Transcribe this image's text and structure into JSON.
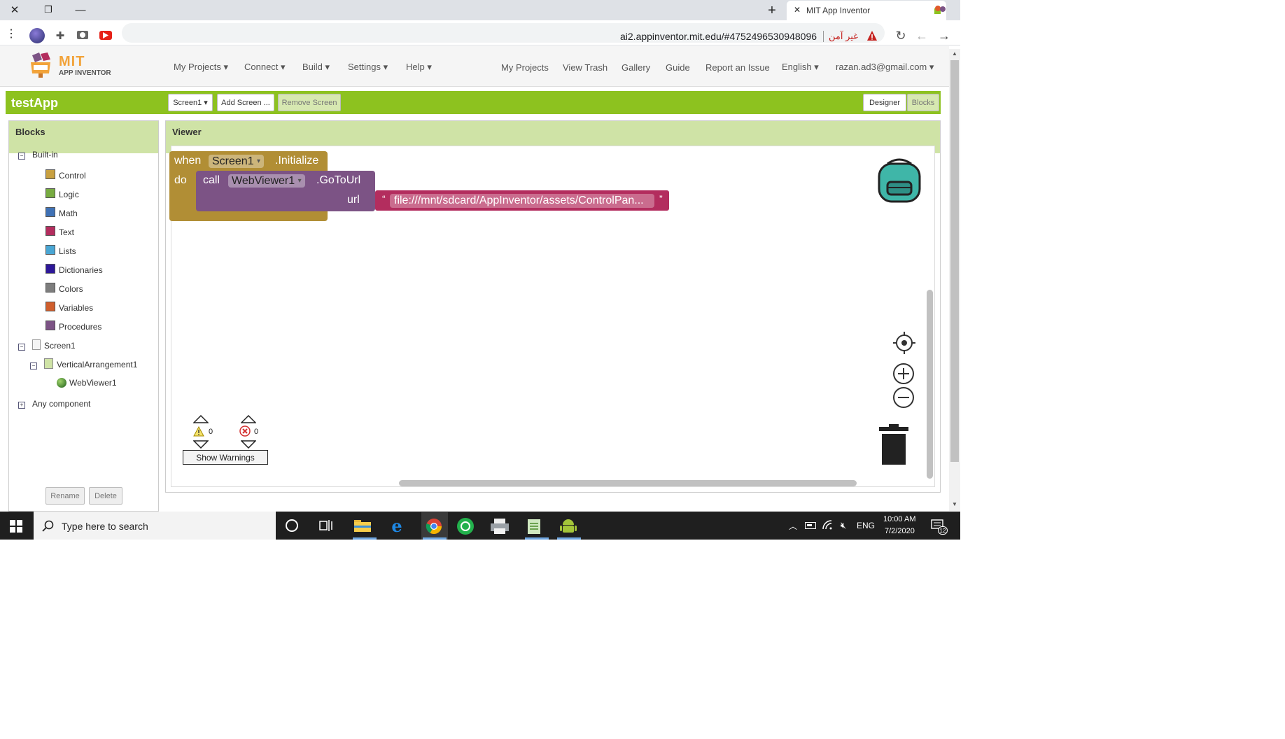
{
  "browser": {
    "tab_title": "MIT App Inventor",
    "url": "ai2.appinventor.mit.edu/#4752496530948096",
    "security_label": "غير آمن"
  },
  "header": {
    "logo_line1": "MIT",
    "logo_line2": "APP INVENTOR",
    "left_menu": [
      "My Projects",
      "Connect",
      "Build",
      "Settings",
      "Help"
    ],
    "right_menu": [
      "My Projects",
      "View Trash",
      "Gallery",
      "Guide",
      "Report an Issue"
    ],
    "language": "English",
    "user": "razan.ad3@gmail.com"
  },
  "project": {
    "name": "testApp",
    "screen_select": "Screen1",
    "add_screen": "Add Screen ...",
    "remove_screen": "Remove Screen",
    "designer": "Designer",
    "blocks": "Blocks"
  },
  "blocks_panel": {
    "title": "Blocks",
    "builtin": "Built-in",
    "items": [
      {
        "label": "Control",
        "color": "#c8a040"
      },
      {
        "label": "Logic",
        "color": "#77ab41"
      },
      {
        "label": "Math",
        "color": "#3f71b5"
      },
      {
        "label": "Text",
        "color": "#b32d5e"
      },
      {
        "label": "Lists",
        "color": "#49a6d4"
      },
      {
        "label": "Dictionaries",
        "color": "#2d1799"
      },
      {
        "label": "Colors",
        "color": "#7d7d7d"
      },
      {
        "label": "Variables",
        "color": "#d05f2d"
      },
      {
        "label": "Procedures",
        "color": "#7c5385"
      }
    ],
    "screen": "Screen1",
    "arrangement": "VerticalArrangement1",
    "webviewer": "WebViewer1",
    "any_component": "Any component",
    "rename": "Rename",
    "delete": "Delete"
  },
  "viewer": {
    "title": "Viewer",
    "block_when": "when",
    "block_screen": "Screen1",
    "block_initialize": ".Initialize",
    "block_do": "do",
    "block_call": "call",
    "block_webviewer": "WebViewer1",
    "block_gotourl": ".GoToUrl",
    "block_url": "url",
    "quote_open": "“",
    "quote_close": "”",
    "url_text": "file:///mnt/sdcard/AppInventor/assets/ControlPan...",
    "warnings_count": "0",
    "errors_count": "0",
    "show_warnings": "Show Warnings"
  },
  "taskbar": {
    "search_placeholder": "Type here to search",
    "lang": "ENG",
    "time": "10:00 AM",
    "date": "7/2/2020",
    "notifications": "12"
  },
  "colors": {
    "event_block": "#b18e35",
    "method_block": "#7c5385",
    "text_block": "#b32d5e",
    "accent_green": "#8dc21f"
  }
}
